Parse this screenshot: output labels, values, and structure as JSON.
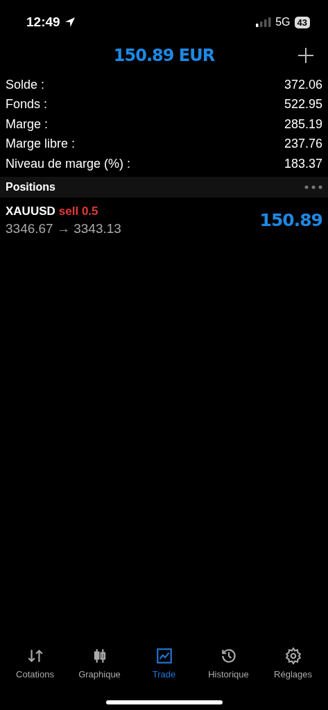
{
  "status_bar": {
    "time": "12:49",
    "network": "5G",
    "battery": "43"
  },
  "header": {
    "title": "150.89 EUR"
  },
  "summary": [
    {
      "label": "Solde :",
      "value": "372.06"
    },
    {
      "label": "Fonds :",
      "value": "522.95"
    },
    {
      "label": "Marge :",
      "value": "285.19"
    },
    {
      "label": "Marge libre :",
      "value": "237.76"
    },
    {
      "label": "Niveau de marge (%) :",
      "value": "183.37"
    }
  ],
  "positions_section": {
    "title": "Positions"
  },
  "positions": [
    {
      "symbol": "XAUUSD",
      "side": "sell 0.5",
      "prices": "3346.67 → 3343.13",
      "profit": "150.89"
    }
  ],
  "tabs": [
    {
      "kind": "quotes",
      "label": "Cotations",
      "selected": false
    },
    {
      "kind": "chart",
      "label": "Graphique",
      "selected": false
    },
    {
      "kind": "trade",
      "label": "Trade",
      "selected": true
    },
    {
      "kind": "history",
      "label": "Historique",
      "selected": false
    },
    {
      "kind": "settings",
      "label": "Réglages",
      "selected": false
    }
  ]
}
